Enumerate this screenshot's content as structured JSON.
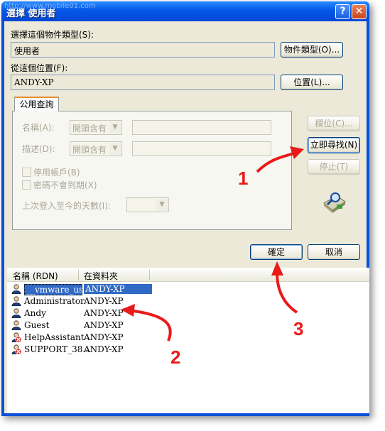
{
  "window": {
    "title": "選擇 使用者",
    "watermark": "http://www.mobile01.com"
  },
  "object_type": {
    "label": "選擇這個物件類型(S):",
    "value": "使用者",
    "button": "物件類型(O)..."
  },
  "location": {
    "label": "從這個位置(F):",
    "value": "ANDY-XP",
    "button": "位置(L)..."
  },
  "query": {
    "tab": "公用查詢",
    "name_label": "名稱(A):",
    "name_op": "開頭含有",
    "desc_label": "描述(D):",
    "desc_op": "開頭含有",
    "disabled_accounts": "停用帳戶(B)",
    "non_expiring": "密碼不會到期(X)",
    "days_label": "上次登入至今的天數(I):"
  },
  "side_buttons": {
    "columns": "欄位(C)...",
    "find_now": "立即尋找(N)",
    "stop": "停止(T)"
  },
  "dialog_buttons": {
    "ok": "確定",
    "cancel": "取消"
  },
  "results": {
    "columns": [
      "名稱 (RDN)",
      "在資料夾"
    ],
    "rows": [
      {
        "name": "__vmware_us...",
        "folder": "ANDY-XP",
        "disabled": false,
        "selected": true
      },
      {
        "name": "Administrator",
        "folder": "ANDY-XP",
        "disabled": false,
        "selected": false
      },
      {
        "name": "Andy",
        "folder": "ANDY-XP",
        "disabled": false,
        "selected": false
      },
      {
        "name": "Guest",
        "folder": "ANDY-XP",
        "disabled": false,
        "selected": false
      },
      {
        "name": "HelpAssistant",
        "folder": "ANDY-XP",
        "disabled": true,
        "selected": false
      },
      {
        "name": "SUPPORT_38...",
        "folder": "ANDY-XP",
        "disabled": true,
        "selected": false
      }
    ]
  },
  "annotations": {
    "one": "1",
    "two": "2",
    "three": "3",
    "color": "#e81a1a"
  }
}
